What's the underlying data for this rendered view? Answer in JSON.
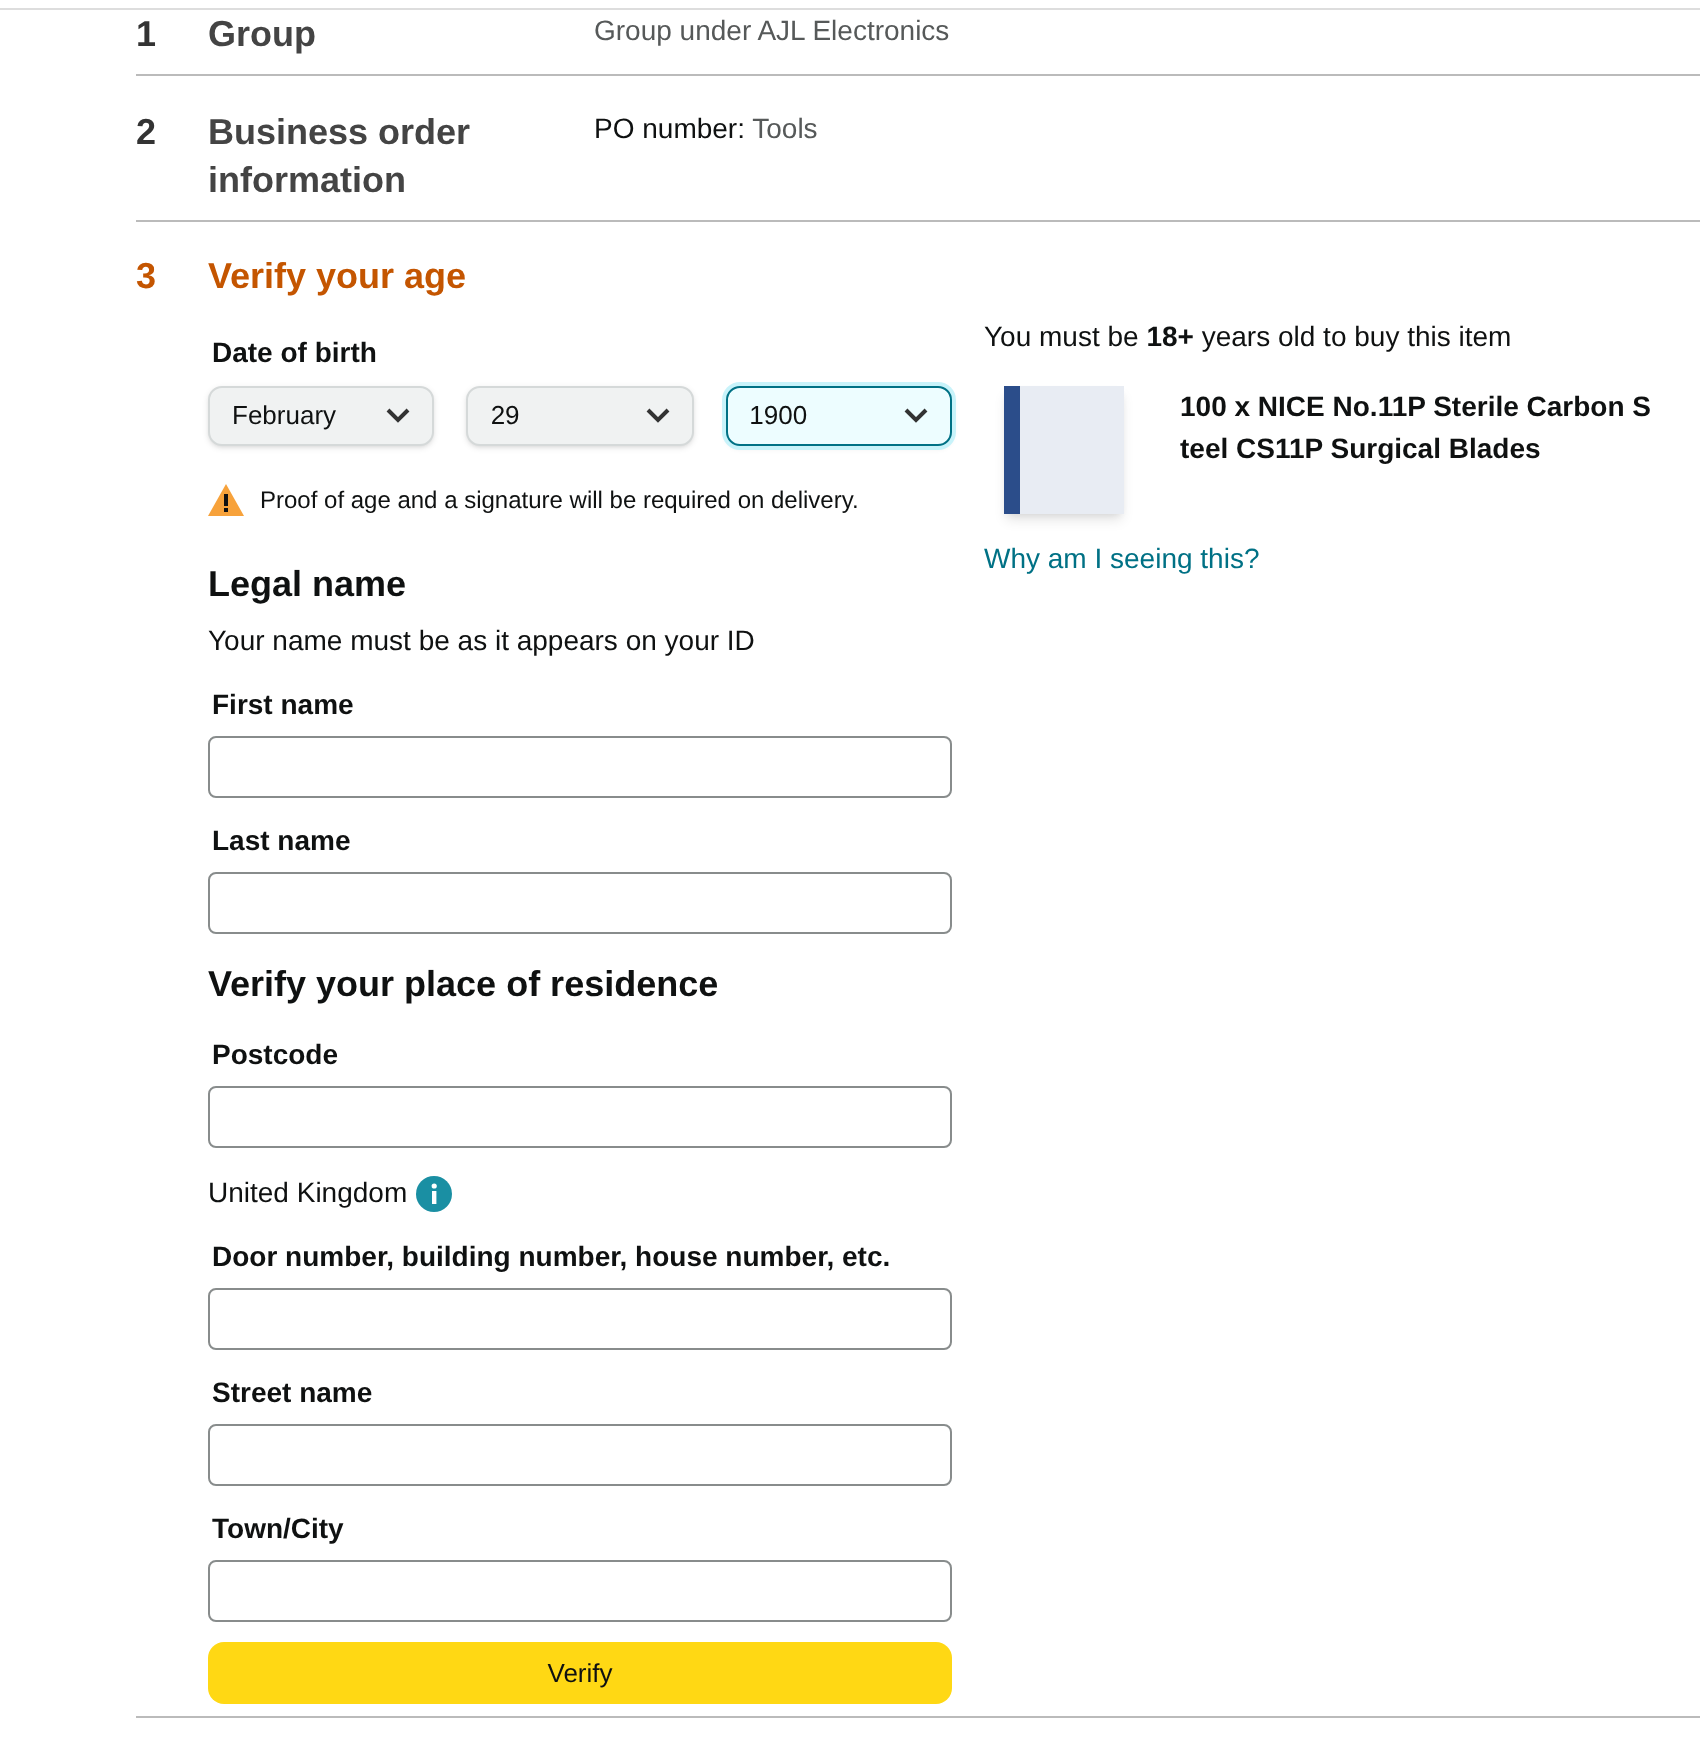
{
  "steps": [
    {
      "number": "1",
      "title": "Group",
      "lines": [
        {
          "text": "Group under AJL Electronics"
        }
      ]
    },
    {
      "number": "2",
      "title": "Business order information",
      "lines": [
        {
          "label": "PO number:",
          "text": "Tools"
        }
      ]
    }
  ],
  "active_step": {
    "number": "3",
    "title": "Verify your age",
    "dob": {
      "label": "Date of birth",
      "selects": [
        {
          "value": "February",
          "focused": false
        },
        {
          "value": "29",
          "focused": false
        },
        {
          "value": "1900",
          "focused": true
        }
      ]
    },
    "warning": "Proof of age and a signature will be required on delivery.",
    "legal": {
      "heading": "Legal name",
      "note": "Your name must be as it appears on your ID",
      "fields": [
        {
          "label": "First name"
        },
        {
          "label": "Last name"
        }
      ]
    },
    "residence": {
      "heading": "Verify your place of residence",
      "fields": [
        {
          "label": "Postcode"
        }
      ],
      "country": "United Kingdom",
      "address_fields": [
        {
          "label": "Door number, building number, house number, etc."
        },
        {
          "label": "Street name"
        },
        {
          "label": "Town/City"
        }
      ]
    },
    "button": "Verify",
    "side": {
      "requirement": "You must be **18+** years old to buy this item",
      "product": "100 x NICE No.11P Sterile Carbon Steel CS11P Surgical Blades",
      "link": "Why am I seeing this?"
    }
  }
}
